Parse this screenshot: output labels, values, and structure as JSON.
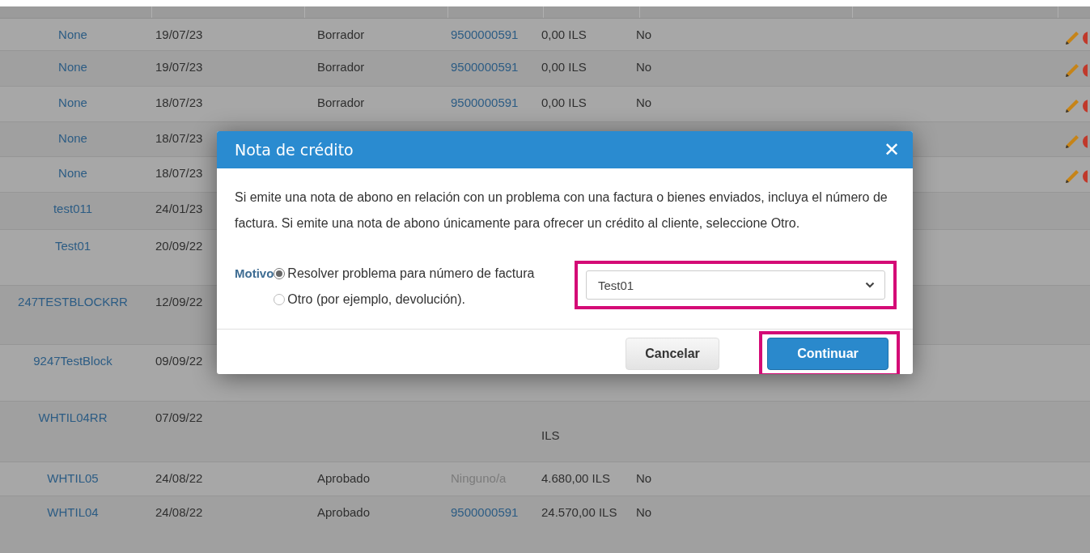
{
  "table": {
    "rows": [
      {
        "reference": "None",
        "date": "19/07/23",
        "status": "Borrador",
        "document": "9500000591",
        "document_linked": true,
        "amount": "0,00 ILS",
        "flag": "No",
        "editable": true
      },
      {
        "reference": "None",
        "date": "19/07/23",
        "status": "Borrador",
        "document": "9500000591",
        "document_linked": true,
        "amount": "0,00 ILS",
        "flag": "No",
        "editable": true
      },
      {
        "reference": "None",
        "date": "18/07/23",
        "status": "Borrador",
        "document": "9500000591",
        "document_linked": true,
        "amount": "0,00 ILS",
        "flag": "No",
        "editable": true
      },
      {
        "reference": "None",
        "date": "18/07/23",
        "editable": true
      },
      {
        "reference": "None",
        "date": "18/07/23",
        "editable": true
      },
      {
        "reference": "test011",
        "date": "24/01/23",
        "editable": false
      },
      {
        "reference": "Test01",
        "date": "20/09/22",
        "editable": false
      },
      {
        "reference": "247TESTBLOCKRR",
        "date": "12/09/22",
        "editable": false
      },
      {
        "reference": "9247TestBlock",
        "date": "09/09/22",
        "editable": false
      },
      {
        "reference": "WHTIL04RR",
        "date": "07/09/22",
        "amount_tail": "ILS",
        "editable": false
      },
      {
        "reference": "WHTIL05",
        "date": "24/08/22",
        "status": "Aprobado",
        "document": "Ninguno/a",
        "document_linked": false,
        "amount": "4.680,00 ILS",
        "flag": "No",
        "editable": false
      },
      {
        "reference": "WHTIL04",
        "date": "24/08/22",
        "status": "Aprobado",
        "document": "9500000591",
        "document_linked": true,
        "amount": "24.570,00 ILS",
        "flag": "No",
        "editable": false
      }
    ]
  },
  "modal": {
    "title": "Nota de crédito",
    "close": "✕",
    "message": "Si emite una nota de abono en relación con un problema con una factura o bienes enviados, incluya el número de factura. Si emite una nota de abono únicamente para ofrecer un crédito al cliente, seleccione Otro.",
    "reason_label": "Motivo",
    "options": [
      {
        "label": "Resolver problema para número de factura",
        "selected": true
      },
      {
        "label": "Otro (por ejemplo, devolución).",
        "selected": false
      }
    ],
    "invoice_select": {
      "value": "Test01",
      "highlighted": true
    },
    "buttons": [
      {
        "label": "Cancelar",
        "kind": "secondary",
        "highlighted": false
      },
      {
        "label": "Continuar",
        "kind": "primary",
        "highlighted": true
      }
    ]
  }
}
